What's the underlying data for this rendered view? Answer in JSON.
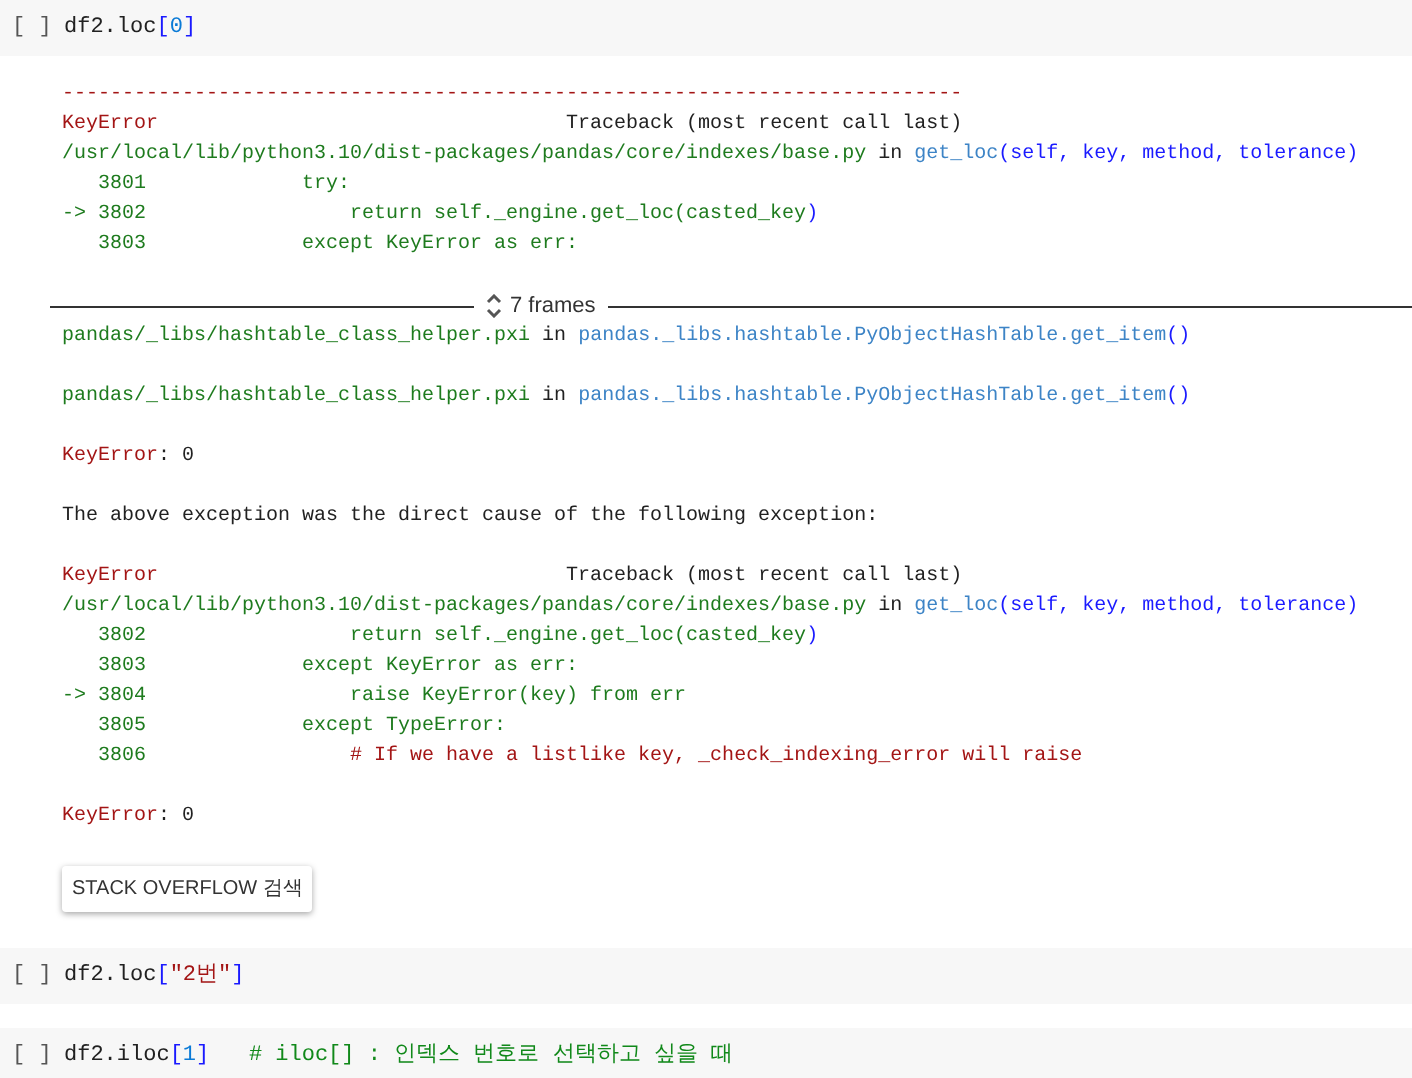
{
  "cells": [
    {
      "gutter": "[ ]",
      "code": [
        {
          "text": "df2.loc",
          "kind": "plain"
        },
        {
          "text": "[",
          "kind": "bracket"
        },
        {
          "text": "0",
          "kind": "number"
        },
        {
          "text": "]",
          "kind": "bracket"
        }
      ],
      "output": [
        {
          "kind": "lines",
          "lines": [
            [
              {
                "text": "---------------------------------------------------------------------------",
                "kind": "error"
              }
            ],
            [
              {
                "text": "KeyError",
                "kind": "error"
              },
              {
                "text": "                                  Traceback (most recent call last)",
                "kind": "plain"
              }
            ],
            [
              {
                "text": "/usr/local/lib/python3.10/dist-packages/pandas/core/indexes/base.py",
                "kind": "file"
              },
              {
                "text": " in ",
                "kind": "plain"
              },
              {
                "text": "get_loc",
                "kind": "func"
              },
              {
                "text": "(self, key, method, tolerance)",
                "kind": "bracket"
              }
            ],
            [
              {
                "text": "   3801             try:",
                "kind": "code"
              }
            ],
            [
              {
                "text": "-> 3802                 return self._engine.get_loc(casted_key",
                "kind": "code"
              },
              {
                "text": ")",
                "kind": "bracket"
              }
            ],
            [
              {
                "text": "   3803             except KeyError as err:",
                "kind": "code"
              }
            ]
          ]
        },
        {
          "kind": "frames",
          "label": "7 frames"
        },
        {
          "kind": "lines",
          "lines": [
            [
              {
                "text": "pandas/_libs/hashtable_class_helper.pxi",
                "kind": "file"
              },
              {
                "text": " in ",
                "kind": "plain"
              },
              {
                "text": "pandas._libs.hashtable.PyObjectHashTable.get_item",
                "kind": "func"
              },
              {
                "text": "()",
                "kind": "bracket"
              }
            ]
          ]
        },
        {
          "kind": "lines",
          "lines": [
            [
              {
                "text": "pandas/_libs/hashtable_class_helper.pxi",
                "kind": "file"
              },
              {
                "text": " in ",
                "kind": "plain"
              },
              {
                "text": "pandas._libs.hashtable.PyObjectHashTable.get_item",
                "kind": "func"
              },
              {
                "text": "()",
                "kind": "bracket"
              }
            ]
          ]
        },
        {
          "kind": "lines",
          "lines": [
            [
              {
                "text": "KeyError",
                "kind": "error"
              },
              {
                "text": ": 0",
                "kind": "plain"
              }
            ]
          ]
        },
        {
          "kind": "lines",
          "lines": [
            [
              {
                "text": "The above exception was the direct cause of the following exception:",
                "kind": "plain"
              }
            ]
          ]
        },
        {
          "kind": "lines",
          "lines": [
            [
              {
                "text": "KeyError",
                "kind": "error"
              },
              {
                "text": "                                  Traceback (most recent call last)",
                "kind": "plain"
              }
            ],
            [
              {
                "text": "/usr/local/lib/python3.10/dist-packages/pandas/core/indexes/base.py",
                "kind": "file"
              },
              {
                "text": " in ",
                "kind": "plain"
              },
              {
                "text": "get_loc",
                "kind": "func"
              },
              {
                "text": "(self, key, method, tolerance)",
                "kind": "bracket"
              }
            ],
            [
              {
                "text": "   3802                 return self._engine.get_loc(casted_key",
                "kind": "code"
              },
              {
                "text": ")",
                "kind": "bracket"
              }
            ],
            [
              {
                "text": "   3803             except KeyError as err:",
                "kind": "code"
              }
            ],
            [
              {
                "text": "-> 3804                 raise KeyError(key) from err",
                "kind": "code"
              }
            ],
            [
              {
                "text": "   3805             except TypeError:",
                "kind": "code"
              }
            ],
            [
              {
                "text": "   3806                 ",
                "kind": "code"
              },
              {
                "text": "# If we have a listlike key, _check_indexing_error will raise",
                "kind": "error"
              }
            ]
          ]
        },
        {
          "kind": "lines",
          "lines": [
            [
              {
                "text": "KeyError",
                "kind": "error"
              },
              {
                "text": ": 0",
                "kind": "plain"
              }
            ]
          ]
        },
        {
          "kind": "button",
          "label": "STACK OVERFLOW 검색"
        }
      ]
    },
    {
      "gutter": "[ ]",
      "code": [
        {
          "text": "df2.loc",
          "kind": "plain"
        },
        {
          "text": "[",
          "kind": "bracket"
        },
        {
          "text": "\"2번\"",
          "kind": "string"
        },
        {
          "text": "]",
          "kind": "bracket"
        }
      ]
    },
    {
      "gutter": "[ ]",
      "code": [
        {
          "text": "df2.iloc",
          "kind": "plain"
        },
        {
          "text": "[",
          "kind": "bracket"
        },
        {
          "text": "1",
          "kind": "number"
        },
        {
          "text": "]",
          "kind": "bracket"
        },
        {
          "text": "   # iloc[] : 인덱스 번호로 선택하고 싶을 때",
          "kind": "comment"
        }
      ]
    }
  ]
}
